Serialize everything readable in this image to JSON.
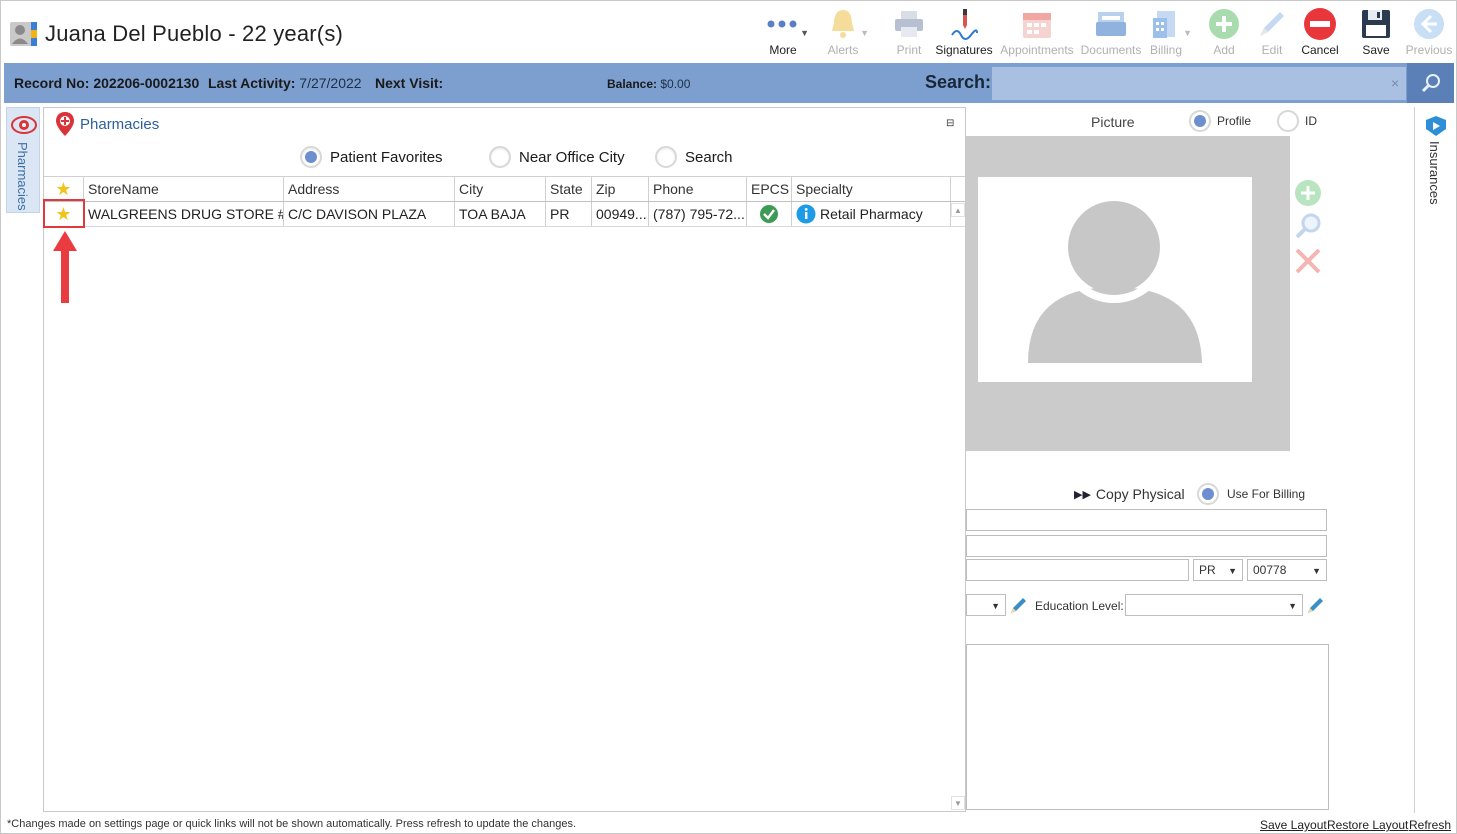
{
  "header": {
    "title": "Juana Del Pueblo - 22 year(s)",
    "toolbar": [
      {
        "id": "more",
        "label": "More",
        "icon": "more-dots-icon",
        "enabled": true
      },
      {
        "id": "alerts",
        "label": "Alerts",
        "icon": "bell-icon",
        "enabled": false
      },
      {
        "id": "print",
        "label": "Print",
        "icon": "printer-icon",
        "enabled": false
      },
      {
        "id": "signatures",
        "label": "Signatures",
        "icon": "signature-pen-icon",
        "enabled": true
      },
      {
        "id": "appointments",
        "label": "Appointments",
        "icon": "calendar-icon",
        "enabled": false
      },
      {
        "id": "documents",
        "label": "Documents",
        "icon": "documents-icon",
        "enabled": false
      },
      {
        "id": "billing",
        "label": "Billing",
        "icon": "billing-icon",
        "enabled": false
      },
      {
        "id": "add",
        "label": "Add",
        "icon": "add-circle-icon",
        "enabled": false
      },
      {
        "id": "edit",
        "label": "Edit",
        "icon": "pencil-icon",
        "enabled": false
      },
      {
        "id": "cancel",
        "label": "Cancel",
        "icon": "cancel-circle-icon",
        "enabled": true
      },
      {
        "id": "save",
        "label": "Save",
        "icon": "floppy-disk-icon",
        "enabled": true
      },
      {
        "id": "previous",
        "label": "Previous",
        "icon": "back-arrow-icon",
        "enabled": false
      }
    ]
  },
  "infobar": {
    "record_label": "Record No:",
    "record_value": "202206-0002130",
    "last_activity_label": "Last Activity:",
    "last_activity_value": "7/27/2022",
    "next_visit_label": "Next Visit:",
    "next_visit_value": "",
    "balance_label": "Balance:",
    "balance_value": "$0.00",
    "search_label": "Search:",
    "search_value": "",
    "search_clear": "×"
  },
  "left_tab": {
    "label": "Pharmacies"
  },
  "right_tab": {
    "label": "Insurances"
  },
  "pharmacies": {
    "title": "Pharmacies",
    "filter_options": [
      {
        "label": "Patient Favorites",
        "selected": true
      },
      {
        "label": "Near Office City",
        "selected": false
      },
      {
        "label": "Search",
        "selected": false
      }
    ],
    "columns": [
      "",
      "StoreName",
      "Address",
      "City",
      "State",
      "Zip",
      "Phone",
      "EPCS",
      "Specialty"
    ],
    "rows": [
      {
        "favorite": true,
        "store_name": "WALGREENS DRUG STORE #...",
        "address": "C/C DAVISON PLAZA",
        "city": "TOA BAJA",
        "state": "PR",
        "zip": "00949...",
        "phone": "(787) 795-72...",
        "epcs": true,
        "specialty": "Retail Pharmacy"
      }
    ]
  },
  "picture": {
    "title": "Picture",
    "options": [
      {
        "label": "Profile",
        "selected": true
      },
      {
        "label": "ID",
        "selected": false
      }
    ]
  },
  "address": {
    "copy_physical_label": "Copy Physical",
    "use_for_billing_label": "Use For Billing",
    "use_for_billing_selected": true,
    "state_value": "PR",
    "zip_value": "00778",
    "education_label": "Education Level:",
    "education_value": ""
  },
  "footer": {
    "note": "*Changes made on settings page or quick links will not be shown automatically. Press refresh to update the changes.",
    "save_layout": "Save Layout",
    "restore_layout": "Restore Layout",
    "refresh": "Refresh"
  },
  "colors": {
    "infobar": "#7d9fcf",
    "search_box": "#a9c0e3",
    "accent_blue": "#2e5f9a",
    "highlight_red": "#e0393e",
    "star": "#f0c419"
  }
}
